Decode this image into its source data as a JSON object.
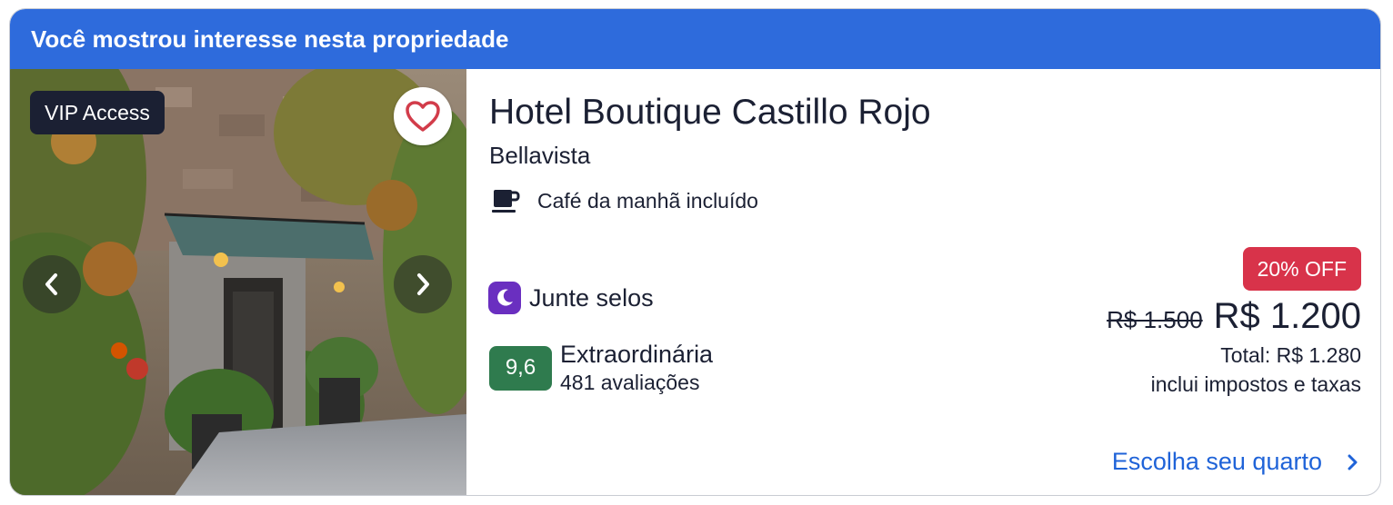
{
  "banner": {
    "text": "Você mostrou interesse nesta propriedade"
  },
  "photo": {
    "vip_label": "VIP Access"
  },
  "hotel": {
    "name": "Hotel Boutique Castillo Rojo",
    "location": "Bellavista",
    "amenity": "Café da manhã incluído",
    "stamps": "Junte selos",
    "rating": {
      "score": "9,6",
      "label": "Extraordinária",
      "reviews": "481 avaliações"
    }
  },
  "price": {
    "discount": "20% OFF",
    "original": "R$ 1.500",
    "current": "R$ 1.200",
    "total": "Total: R$ 1.280",
    "taxes_note": "inclui impostos e taxas"
  },
  "cta": {
    "label": "Escolha seu quarto"
  },
  "colors": {
    "banner": "#2e6bdc",
    "vip_badge": "#1b2033",
    "discount": "#d8334a",
    "score": "#2f7b4e",
    "stamps_badge": "#6a2fc0",
    "link": "#1f63d8",
    "heart": "#d23c4a"
  },
  "icons": {
    "favorite": "heart-outline-icon",
    "prev": "chevron-left-icon",
    "next": "chevron-right-icon",
    "amenity": "coffee-cup-icon",
    "stamps": "moon-icon",
    "cta": "chevron-right-icon"
  }
}
